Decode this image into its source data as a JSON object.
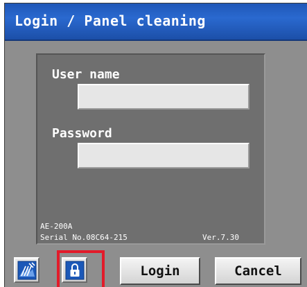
{
  "window": {
    "title": "Login / Panel cleaning"
  },
  "form": {
    "username_label": "User name",
    "username_value": "",
    "password_label": "Password",
    "password_value": ""
  },
  "device": {
    "model": "AE-200A",
    "serial": "Serial No.08C64-215",
    "version": "Ver.7.30"
  },
  "toolbar": {
    "panel_cleaning_icon": "panel-cleaning-icon",
    "lock_icon": "lock-icon",
    "login_label": "Login",
    "cancel_label": "Cancel"
  },
  "colors": {
    "title_bar": "#2a69cf",
    "background": "#8e8e8e",
    "panel": "#6f6f6f",
    "highlight": "#e21b2a"
  }
}
